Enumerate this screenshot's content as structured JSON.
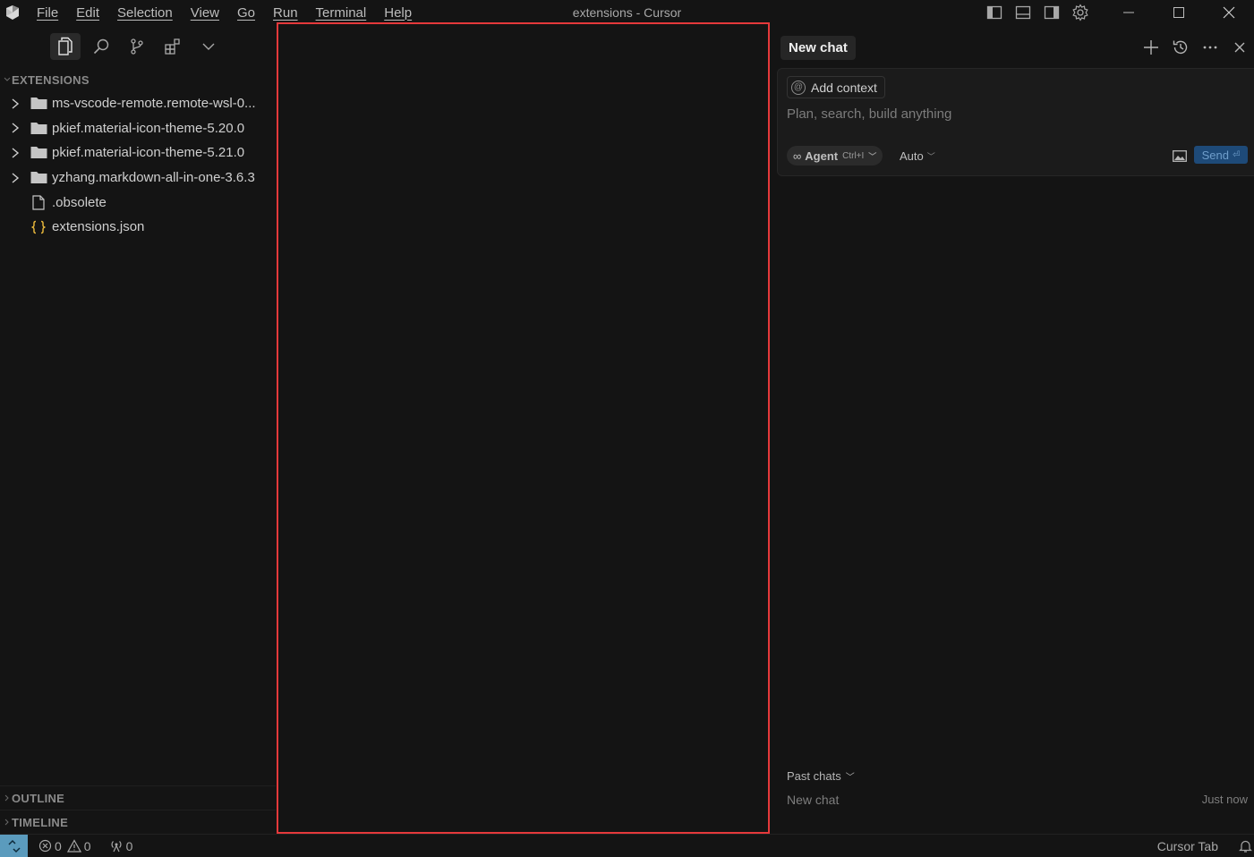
{
  "titlebar": {
    "title": "extensions - Cursor",
    "menu": [
      {
        "label": "File"
      },
      {
        "label": "Edit"
      },
      {
        "label": "Selection"
      },
      {
        "label": "View"
      },
      {
        "label": "Go"
      },
      {
        "label": "Run"
      },
      {
        "label": "Terminal"
      },
      {
        "label": "Help"
      }
    ]
  },
  "sidebar": {
    "section_title": "EXTENSIONS",
    "items": [
      {
        "label": "ms-vscode-remote.remote-wsl-0...",
        "type": "folder"
      },
      {
        "label": "pkief.material-icon-theme-5.20.0",
        "type": "folder"
      },
      {
        "label": "pkief.material-icon-theme-5.21.0",
        "type": "folder"
      },
      {
        "label": "yzhang.markdown-all-in-one-3.6.3",
        "type": "folder"
      },
      {
        "label": ".obsolete",
        "type": "file"
      },
      {
        "label": "extensions.json",
        "type": "json"
      }
    ],
    "outline": "OUTLINE",
    "timeline": "TIMELINE"
  },
  "chat": {
    "tab_label": "New chat",
    "add_context": "Add context",
    "prompt_placeholder": "Plan, search, build anything",
    "agent_label": "Agent",
    "agent_shortcut": "Ctrl+I",
    "model_label": "Auto",
    "send_label": "Send",
    "past_chats_label": "Past chats",
    "past_chats": [
      {
        "title": "New chat",
        "time": "Just now"
      }
    ]
  },
  "statusbar": {
    "errors": "0",
    "warnings": "0",
    "ports": "0",
    "cursor_tab": "Cursor Tab"
  },
  "colors": {
    "background": "#141414",
    "editor_border": "#e5393b",
    "remote_button": "#5b9bbd",
    "send_button": "#1e4a78",
    "json_icon": "#e5b53b"
  }
}
